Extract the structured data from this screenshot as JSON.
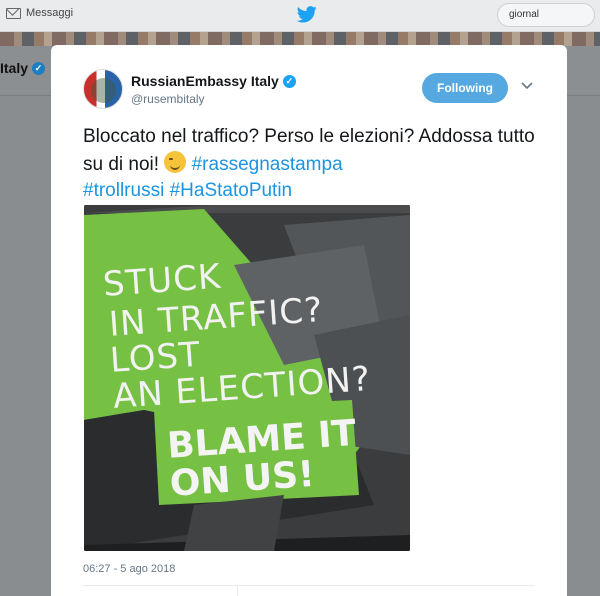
{
  "topbar": {
    "messages_label": "Messaggi",
    "search_value": "giornal",
    "icons": [
      "mail-icon",
      "twitter-bird-icon"
    ]
  },
  "background_profile": {
    "name": "Italy"
  },
  "tweet": {
    "display_name": "RussianEmbassy Italy",
    "handle": "@rusembitaly",
    "follow_button": "Following",
    "text_plain": "Bloccato nel traffico? Perso le elezioni? Addossa tutto su di noi!",
    "hashtags": [
      "#rassegnastampa",
      "#trollrussi",
      "#HaStatoPutin"
    ],
    "emoji": "winking-face",
    "timestamp": "06:27 - 5 ago 2018"
  },
  "image": {
    "sign_lines": [
      "STUCK",
      "IN TRAFFIC?",
      "LOST",
      "AN ELECTION?"
    ],
    "blame_lines": [
      "BLAME IT",
      "ON US!"
    ]
  },
  "colors": {
    "accent": "#1da1f2",
    "hashtag": "#1b95e0",
    "follow_button": "#55a8e0",
    "sign_green": "#76c043"
  }
}
